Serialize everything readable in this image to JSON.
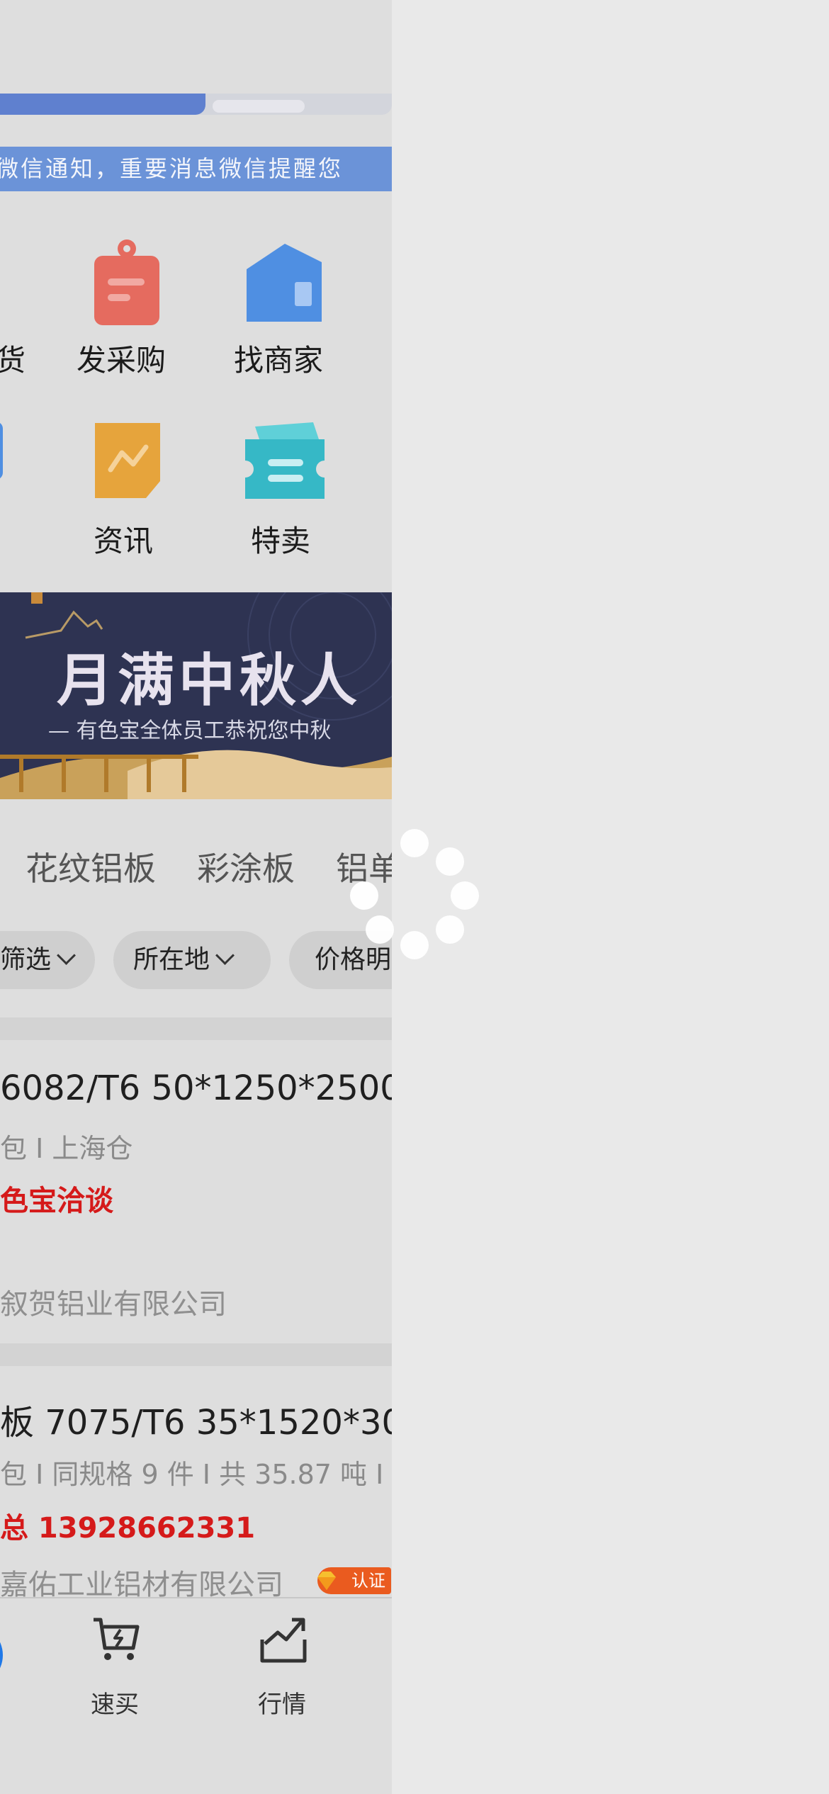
{
  "notice": {
    "text": "微信通知，重要消息微信提醒您"
  },
  "grid": {
    "row1": [
      {
        "label": "货",
        "icon": "partial-icon"
      },
      {
        "label": "发采购",
        "icon": "clipboard-icon"
      },
      {
        "label": "找商家",
        "icon": "store-icon"
      }
    ],
    "row2": [
      {
        "label": "",
        "icon": "partial-blue-icon"
      },
      {
        "label": "资讯",
        "icon": "news-icon"
      },
      {
        "label": "特卖",
        "icon": "ticket-icon"
      }
    ]
  },
  "banner": {
    "title": "月满中秋人",
    "subtitle": "— 有色宝全体员工恭祝您中秋"
  },
  "categories": [
    "花纹铝板",
    "彩涂板",
    "铝单"
  ],
  "filters": [
    "筛选",
    "所在地",
    "价格明"
  ],
  "listings": [
    {
      "title": "6082/T6 50*1250*2500",
      "meta": "包 I 上海仓",
      "price": "色宝洽谈",
      "company": "叙贺铝业有限公司"
    },
    {
      "title": "板 7075/T6 35*1520*302",
      "meta": "包 I 同规格 9 件 I 共 35.87 吨 I",
      "price": "总 13928662331",
      "company": "嘉佑工业铝材有限公司",
      "badge": "认证"
    }
  ],
  "tabbar": [
    {
      "label": "速买",
      "icon": "cart-icon"
    },
    {
      "label": "行情",
      "icon": "trend-chart-icon"
    }
  ],
  "colors": {
    "accent": "#5f80cf",
    "price": "#d51a1a",
    "badge": "#ea5b1f",
    "banner_bg": "#2e3352"
  }
}
